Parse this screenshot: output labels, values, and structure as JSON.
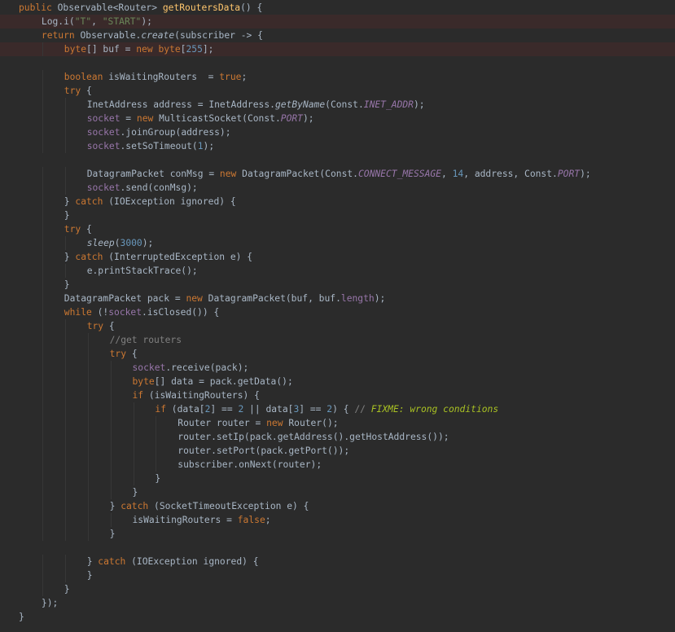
{
  "editor": {
    "theme_colors": {
      "background": "#2b2b2b",
      "text": "#a9b7c6",
      "keyword": "#cc7832",
      "method_decl": "#ffc66d",
      "string": "#6a8759",
      "number": "#6897bb",
      "field": "#9876aa",
      "comment": "#808080",
      "todo": "#a8c023",
      "highlight_line": "#3a2a2a"
    },
    "lines": [
      {
        "indent": 1,
        "hl": false,
        "tokens": [
          [
            "kw",
            "public "
          ],
          [
            "tx",
            "Observable<Router> "
          ],
          [
            "fn",
            "getRoutersData"
          ],
          [
            "tx",
            "() {"
          ]
        ]
      },
      {
        "indent": 2,
        "hl": true,
        "tokens": [
          [
            "tx",
            "Log."
          ],
          [
            "tx",
            "i("
          ],
          [
            "st",
            "\"T\""
          ],
          [
            "tx",
            ", "
          ],
          [
            "st",
            "\"START\""
          ],
          [
            "tx",
            ");"
          ]
        ]
      },
      {
        "indent": 2,
        "hl": false,
        "tokens": [
          [
            "kw",
            "return "
          ],
          [
            "tx",
            "Observable."
          ],
          [
            "sm",
            "create"
          ],
          [
            "tx",
            "(subscriber -> {"
          ]
        ]
      },
      {
        "indent": 3,
        "hl": true,
        "tokens": [
          [
            "kw",
            "byte"
          ],
          [
            "tx",
            "[] buf = "
          ],
          [
            "kw",
            "new byte"
          ],
          [
            "tx",
            "["
          ],
          [
            "nm",
            "255"
          ],
          [
            "tx",
            "];"
          ]
        ]
      },
      {
        "indent": 0,
        "hl": false,
        "tokens": []
      },
      {
        "indent": 3,
        "hl": false,
        "tokens": [
          [
            "kw",
            "boolean "
          ],
          [
            "tx",
            "isWaitingRouters  = "
          ],
          [
            "kw",
            "true"
          ],
          [
            "tx",
            ";"
          ]
        ]
      },
      {
        "indent": 3,
        "hl": false,
        "tokens": [
          [
            "kw",
            "try "
          ],
          [
            "tx",
            "{"
          ]
        ]
      },
      {
        "indent": 4,
        "hl": false,
        "tokens": [
          [
            "tx",
            "InetAddress address = InetAddress."
          ],
          [
            "sm",
            "getByName"
          ],
          [
            "tx",
            "(Const."
          ],
          [
            "sf",
            "INET_ADDR"
          ],
          [
            "tx",
            ");"
          ]
        ]
      },
      {
        "indent": 4,
        "hl": false,
        "tokens": [
          [
            "fld",
            "socket "
          ],
          [
            "tx",
            "= "
          ],
          [
            "kw",
            "new "
          ],
          [
            "tx",
            "MulticastSocket(Const."
          ],
          [
            "sf",
            "PORT"
          ],
          [
            "tx",
            ");"
          ]
        ]
      },
      {
        "indent": 4,
        "hl": false,
        "tokens": [
          [
            "fld",
            "socket"
          ],
          [
            "tx",
            ".joinGroup(address);"
          ]
        ]
      },
      {
        "indent": 4,
        "hl": false,
        "tokens": [
          [
            "fld",
            "socket"
          ],
          [
            "tx",
            ".setSoTimeout("
          ],
          [
            "nm",
            "1"
          ],
          [
            "tx",
            ");"
          ]
        ]
      },
      {
        "indent": 0,
        "hl": false,
        "tokens": []
      },
      {
        "indent": 4,
        "hl": false,
        "tokens": [
          [
            "tx",
            "DatagramPacket conMsg = "
          ],
          [
            "kw",
            "new "
          ],
          [
            "tx",
            "DatagramPacket(Const."
          ],
          [
            "sf",
            "CONNECT_MESSAGE"
          ],
          [
            "tx",
            ", "
          ],
          [
            "nm",
            "14"
          ],
          [
            "tx",
            ", address, Const."
          ],
          [
            "sf",
            "PORT"
          ],
          [
            "tx",
            ");"
          ]
        ]
      },
      {
        "indent": 4,
        "hl": false,
        "tokens": [
          [
            "fld",
            "socket"
          ],
          [
            "tx",
            ".send(conMsg);"
          ]
        ]
      },
      {
        "indent": 3,
        "hl": false,
        "tokens": [
          [
            "tx",
            "} "
          ],
          [
            "kw",
            "catch "
          ],
          [
            "tx",
            "(IOException ignored) {"
          ]
        ]
      },
      {
        "indent": 3,
        "hl": false,
        "tokens": [
          [
            "tx",
            "}"
          ]
        ]
      },
      {
        "indent": 3,
        "hl": false,
        "tokens": [
          [
            "kw",
            "try "
          ],
          [
            "tx",
            "{"
          ]
        ]
      },
      {
        "indent": 4,
        "hl": false,
        "tokens": [
          [
            "sm",
            "sleep"
          ],
          [
            "tx",
            "("
          ],
          [
            "nm",
            "3000"
          ],
          [
            "tx",
            ");"
          ]
        ]
      },
      {
        "indent": 3,
        "hl": false,
        "tokens": [
          [
            "tx",
            "} "
          ],
          [
            "kw",
            "catch "
          ],
          [
            "tx",
            "(InterruptedException e) {"
          ]
        ]
      },
      {
        "indent": 4,
        "hl": false,
        "tokens": [
          [
            "tx",
            "e.printStackTrace();"
          ]
        ]
      },
      {
        "indent": 3,
        "hl": false,
        "tokens": [
          [
            "tx",
            "}"
          ]
        ]
      },
      {
        "indent": 3,
        "hl": false,
        "tokens": [
          [
            "tx",
            "DatagramPacket pack = "
          ],
          [
            "kw",
            "new "
          ],
          [
            "tx",
            "DatagramPacket(buf, buf."
          ],
          [
            "fld",
            "length"
          ],
          [
            "tx",
            ");"
          ]
        ]
      },
      {
        "indent": 3,
        "hl": false,
        "tokens": [
          [
            "kw",
            "while "
          ],
          [
            "tx",
            "(!"
          ],
          [
            "fld",
            "socket"
          ],
          [
            "tx",
            ".isClosed()) {"
          ]
        ]
      },
      {
        "indent": 4,
        "hl": false,
        "tokens": [
          [
            "kw",
            "try "
          ],
          [
            "tx",
            "{"
          ]
        ]
      },
      {
        "indent": 5,
        "hl": false,
        "tokens": [
          [
            "cm",
            "//get routers"
          ]
        ]
      },
      {
        "indent": 5,
        "hl": false,
        "tokens": [
          [
            "kw",
            "try "
          ],
          [
            "tx",
            "{"
          ]
        ]
      },
      {
        "indent": 6,
        "hl": false,
        "tokens": [
          [
            "fld",
            "socket"
          ],
          [
            "tx",
            ".receive(pack);"
          ]
        ]
      },
      {
        "indent": 6,
        "hl": false,
        "tokens": [
          [
            "kw",
            "byte"
          ],
          [
            "tx",
            "[] data = pack.getData();"
          ]
        ]
      },
      {
        "indent": 6,
        "hl": false,
        "tokens": [
          [
            "kw",
            "if "
          ],
          [
            "tx",
            "(isWaitingRouters) {"
          ]
        ]
      },
      {
        "indent": 7,
        "hl": false,
        "tokens": [
          [
            "kw",
            "if "
          ],
          [
            "tx",
            "(data["
          ],
          [
            "nm",
            "2"
          ],
          [
            "tx",
            "] == "
          ],
          [
            "nm",
            "2 "
          ],
          [
            "tx",
            "|| data["
          ],
          [
            "nm",
            "3"
          ],
          [
            "tx",
            "] == "
          ],
          [
            "nm",
            "2"
          ],
          [
            "tx",
            ") { "
          ],
          [
            "cm",
            "// "
          ],
          [
            "todo",
            "FIXME: wrong conditions"
          ]
        ]
      },
      {
        "indent": 8,
        "hl": false,
        "tokens": [
          [
            "tx",
            "Router router = "
          ],
          [
            "kw",
            "new "
          ],
          [
            "tx",
            "Router();"
          ]
        ]
      },
      {
        "indent": 8,
        "hl": false,
        "tokens": [
          [
            "tx",
            "router.setIp(pack.getAddress().getHostAddress());"
          ]
        ]
      },
      {
        "indent": 8,
        "hl": false,
        "tokens": [
          [
            "tx",
            "router.setPort(pack.getPort());"
          ]
        ]
      },
      {
        "indent": 8,
        "hl": false,
        "tokens": [
          [
            "tx",
            "subscriber.onNext(router);"
          ]
        ]
      },
      {
        "indent": 7,
        "hl": false,
        "tokens": [
          [
            "tx",
            "}"
          ]
        ]
      },
      {
        "indent": 6,
        "hl": false,
        "tokens": [
          [
            "tx",
            "}"
          ]
        ]
      },
      {
        "indent": 5,
        "hl": false,
        "tokens": [
          [
            "tx",
            "} "
          ],
          [
            "kw",
            "catch "
          ],
          [
            "tx",
            "(SocketTimeoutException e) {"
          ]
        ]
      },
      {
        "indent": 6,
        "hl": false,
        "tokens": [
          [
            "tx",
            "isWaitingRouters = "
          ],
          [
            "kw",
            "false"
          ],
          [
            "tx",
            ";"
          ]
        ]
      },
      {
        "indent": 5,
        "hl": false,
        "tokens": [
          [
            "tx",
            "}"
          ]
        ]
      },
      {
        "indent": 0,
        "hl": false,
        "tokens": []
      },
      {
        "indent": 4,
        "hl": false,
        "tokens": [
          [
            "tx",
            "} "
          ],
          [
            "kw",
            "catch "
          ],
          [
            "tx",
            "(IOException ignored) {"
          ]
        ]
      },
      {
        "indent": 4,
        "hl": false,
        "tokens": [
          [
            "tx",
            "}"
          ]
        ]
      },
      {
        "indent": 3,
        "hl": false,
        "tokens": [
          [
            "tx",
            "}"
          ]
        ]
      },
      {
        "indent": 2,
        "hl": false,
        "tokens": [
          [
            "tx",
            "});"
          ]
        ]
      },
      {
        "indent": 1,
        "hl": false,
        "tokens": [
          [
            "tx",
            "}"
          ]
        ]
      }
    ]
  }
}
